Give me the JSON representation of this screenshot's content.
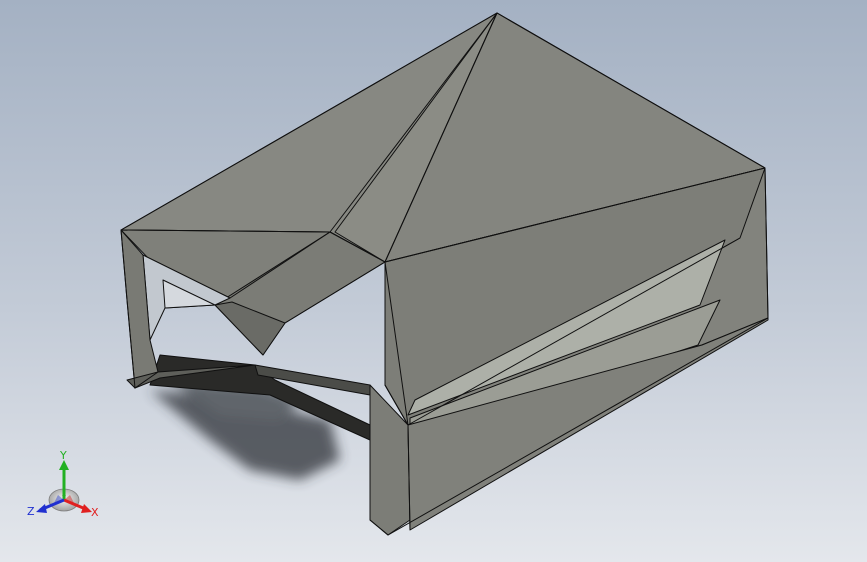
{
  "viewport": {
    "background_top": "#a4b1c3",
    "background_bottom": "#e4e7ec"
  },
  "model": {
    "face_color": "#878882",
    "edge_color": "#101010",
    "shadow_color": "#2e3338"
  },
  "triad": {
    "x_label": "X",
    "y_label": "Y",
    "z_label": "Z",
    "x_color": "#e02020",
    "y_color": "#22b022",
    "z_color": "#2030d0"
  }
}
